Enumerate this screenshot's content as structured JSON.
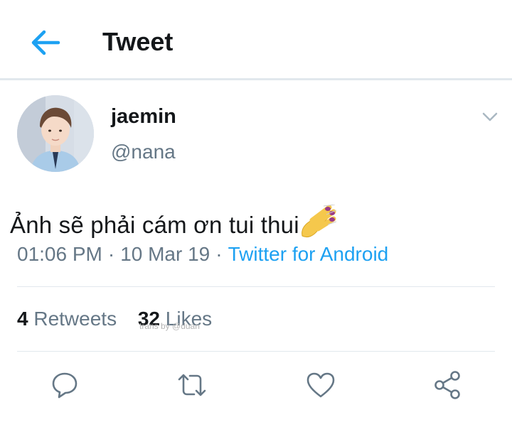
{
  "header": {
    "title": "Tweet",
    "back_icon": "arrow-left-icon"
  },
  "tweet": {
    "display_name": "jaemin",
    "handle": "@nana",
    "text": "Ảnh sẽ phải cám ơn tui thui",
    "emoji": "nail-polish-emoji",
    "time": "01:06 PM",
    "date": "10 Mar 19",
    "separator": "·",
    "source": "Twitter for Android"
  },
  "stats": {
    "retweets_count": "4",
    "retweets_label": "Retweets",
    "likes_count": "32",
    "likes_label": "Likes"
  },
  "watermark": "trans by @duan",
  "actions": [
    "reply-icon",
    "retweet-icon",
    "like-icon",
    "share-icon"
  ],
  "colors": {
    "accent": "#1da1f2",
    "muted": "#657786",
    "text": "#14171a",
    "divider": "#e1e8ed"
  }
}
